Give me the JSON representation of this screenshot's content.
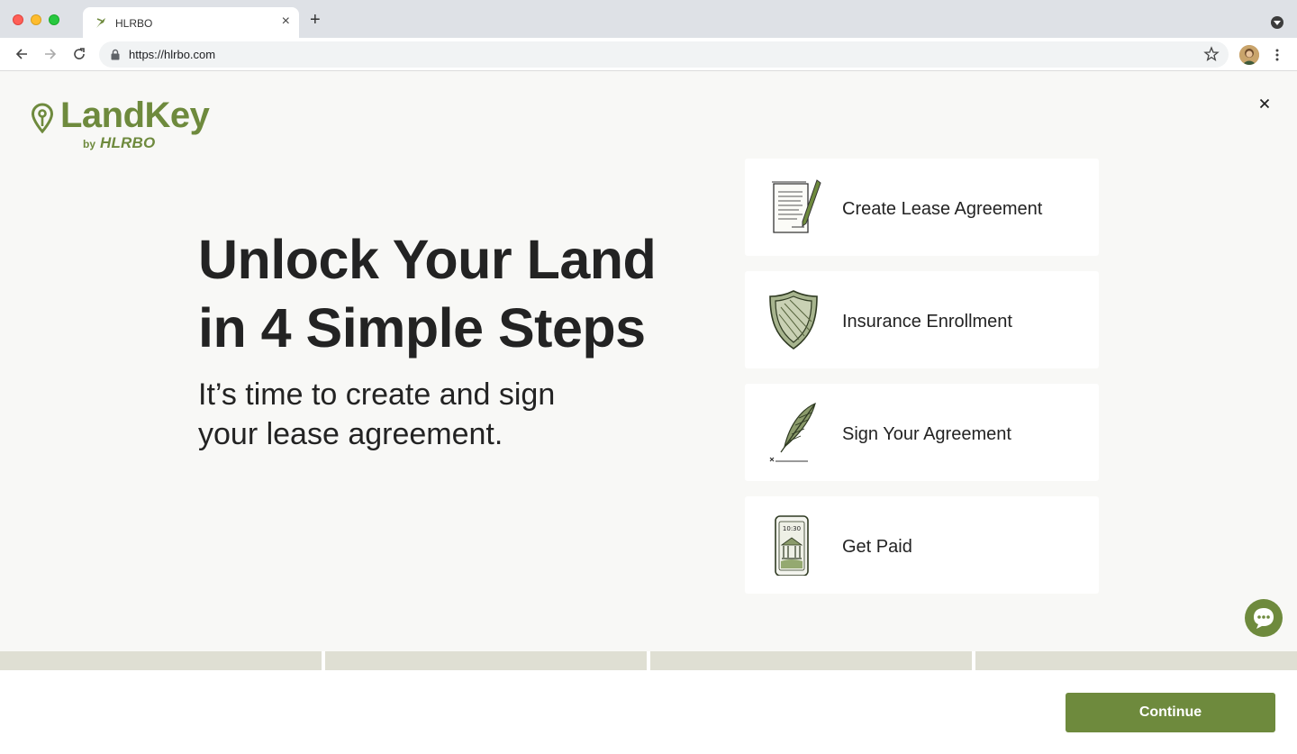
{
  "browser": {
    "tab_title": "HLRBO",
    "url": "https://hlrbo.com",
    "new_tab_label": "+",
    "tab_close_label": "×"
  },
  "logo": {
    "word": "LandKey",
    "by": "by",
    "brand": "HLRBO"
  },
  "hero": {
    "headline_line1": "Unlock Your Land",
    "headline_line2": "in 4 Simple Steps",
    "subhead_line1": "It’s time to create and sign",
    "subhead_line2": "your lease agreement."
  },
  "steps": [
    {
      "label": "Create Lease Agreement",
      "icon": "lease-document-icon"
    },
    {
      "label": "Insurance Enrollment",
      "icon": "shield-icon"
    },
    {
      "label": "Sign Your Agreement",
      "icon": "quill-icon"
    },
    {
      "label": "Get Paid",
      "icon": "phone-bank-icon",
      "phone_time": "10:30"
    }
  ],
  "progress": {
    "segments": 4,
    "completed": 0
  },
  "footer": {
    "continue_label": "Continue"
  },
  "colors": {
    "brand": "#6e8a3d",
    "progress_segment": "#dfdfd3",
    "page_bg": "#f8f8f6"
  }
}
